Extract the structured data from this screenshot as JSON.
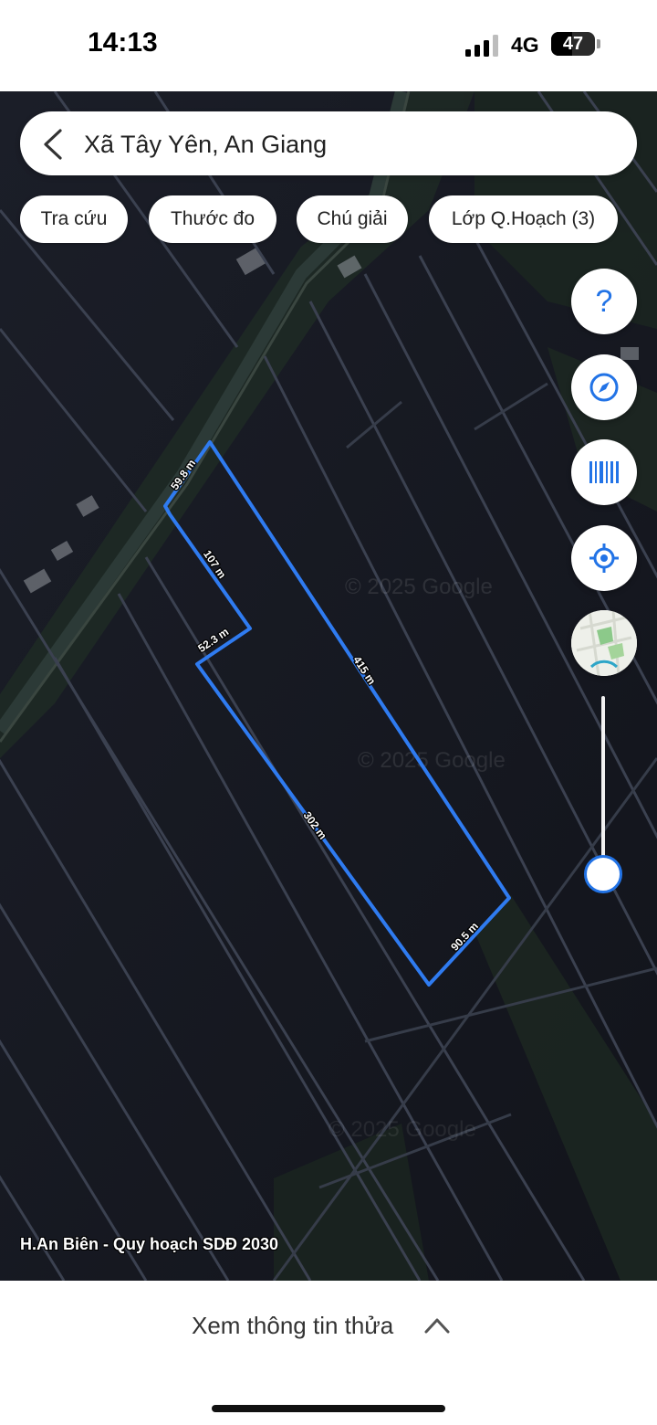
{
  "status_bar": {
    "time": "14:13",
    "network": "4G",
    "battery": "47",
    "battery_level": 0.47
  },
  "search": {
    "back_icon": "chevron-left-icon",
    "location": "Xã Tây Yên, An Giang"
  },
  "chips": [
    {
      "label": "Tra cứu"
    },
    {
      "label": "Thước đo"
    },
    {
      "label": "Chú giải"
    },
    {
      "label": "Lớp Q.Hoạch (3)"
    }
  ],
  "side_buttons": [
    {
      "icon": "help-icon",
      "glyph": "?"
    },
    {
      "icon": "compass-icon"
    },
    {
      "icon": "barcode-icon"
    },
    {
      "icon": "locate-icon"
    },
    {
      "icon": "basemap-thumbnail-icon"
    }
  ],
  "map": {
    "watermark": "© 2025 Google",
    "caption": "H.An Biên - Quy hoạch SDĐ 2030",
    "parcel_color": "#2f7bf0",
    "edge_labels": [
      "59.8 m",
      "107 m",
      "52.3 m",
      "415 m",
      "302 m",
      "90.5 m"
    ]
  },
  "bottom": {
    "info_label": "Xem thông tin thửa",
    "chevron_icon": "chevron-up-icon"
  },
  "colors": {
    "accent": "#2273e6",
    "map_dark": "#151820"
  }
}
